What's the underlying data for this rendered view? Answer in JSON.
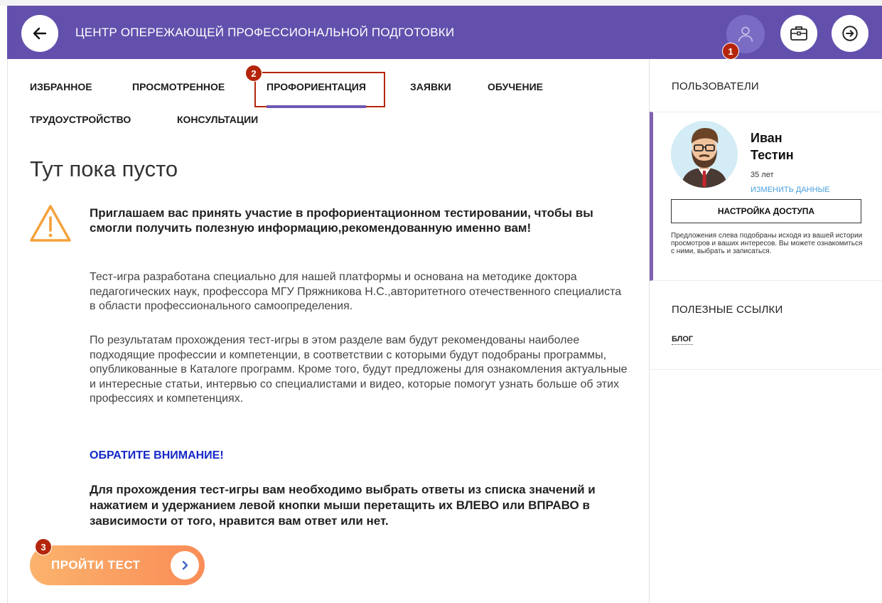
{
  "header": {
    "title": "ЦЕНТР ОПЕРЕЖАЮЩЕЙ ПРОФЕССИОНАЛЬНОЙ ПОДГОТОВКИ",
    "bg_color": "#6350ad",
    "icons": [
      "arrow-left-icon",
      "user-icon",
      "briefcase-icon",
      "logout-icon"
    ]
  },
  "markers": {
    "one": "1",
    "two": "2",
    "three": "3"
  },
  "tabs": [
    {
      "label": "ИЗБРАННОЕ"
    },
    {
      "label": "ПРОСМОТРЕННОЕ"
    },
    {
      "label": "ПРОФОРИЕНТАЦИЯ",
      "active": true
    },
    {
      "label": "ЗАЯВКИ"
    },
    {
      "label": "ОБУЧЕНИЕ"
    },
    {
      "label": "ТРУДОУСТРОЙСТВО"
    },
    {
      "label": "КОНСУЛЬТАЦИИ"
    }
  ],
  "main": {
    "empty_title": "Тут пока пусто",
    "lead": "Приглашаем вас принять участие в профориентационном тестировании, чтобы вы смогли получить полезную информацию,рекомендованную именно вам!",
    "para1": "Тест-игра разработана специально для нашей платформы и основана на методике доктора педагогических наук, профессора МГУ Пряжникова Н.С.,авторитетного отечественного специалиста в области профессионального самоопределения.",
    "para2": "По результатам прохождения тест-игры в этом разделе вам будут рекомендованы наиболее подходящие профессии и компетенции, в соответствии с которыми будут подобраны программы, опубликованные в Каталоге программ. Кроме того, будут предложены для ознакомления актуальные и интересные статьи, интервью со специалистами и видео, которые помогут узнать больше об этих профессиях и компетенциях.",
    "notice": "ОБРАТИТЕ ВНИМАНИЕ!",
    "instruction": "Для прохождения тест-игры вам необходимо выбрать ответы из списка значений и нажатием и удержанием левой кнопки мыши перетащить их ВЛЕВО или ВПРАВО в зависимости от того, нравится вам ответ или нет.",
    "cta_label": "ПРОЙТИ ТЕСТ"
  },
  "sidebar": {
    "users_heading": "ПОЛЬЗОВАТЕЛИ",
    "user": {
      "first_name": "Иван",
      "last_name": "Тестин",
      "age": "35 лет",
      "edit_label": "ИЗМЕНИТЬ ДАННЫЕ",
      "access_button": "НАСТРОЙКА ДОСТУПА",
      "note": "Предложения слева подобраны исходя из вашей истории просмотров и ваших интересов. Вы можете ознакомиться с ними, выбрать и записаться."
    },
    "links_heading": "ПОЛЕЗНЫЕ ССЫЛКИ",
    "links": [
      {
        "label": "БЛОГ"
      }
    ]
  }
}
